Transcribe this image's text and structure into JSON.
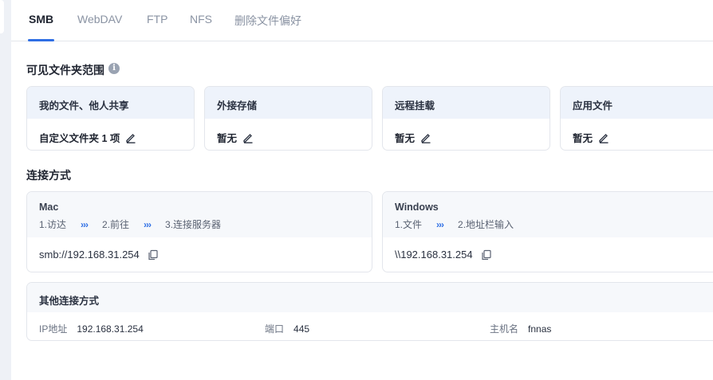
{
  "tabs": [
    "SMB",
    "WebDAV",
    "FTP",
    "NFS",
    "删除文件偏好"
  ],
  "visible_folders": {
    "title": "可见文件夹范围",
    "info_icon": "info-icon",
    "cards": [
      {
        "header": "我的文件、他人共享",
        "value": "自定义文件夹 1 项"
      },
      {
        "header": "外接存储",
        "value": "暂无"
      },
      {
        "header": "远程挂载",
        "value": "暂无"
      },
      {
        "header": "应用文件",
        "value": "暂无"
      }
    ]
  },
  "connection": {
    "title": "连接方式",
    "mac": {
      "label": "Mac",
      "steps": [
        "1.访达",
        "2.前往",
        "3.连接服务器"
      ],
      "address": "smb://192.168.31.254"
    },
    "windows": {
      "label": "Windows",
      "steps": [
        "1.文件",
        "2.地址栏输入"
      ],
      "address": "\\\\192.168.31.254"
    },
    "other": {
      "title": "其他连接方式",
      "ip_label": "IP地址",
      "ip_value": "192.168.31.254",
      "port_label": "端口",
      "port_value": "445",
      "host_label": "主机名",
      "host_value": "fnnas"
    }
  },
  "colors": {
    "accent": "#2f6fe4",
    "card_header": "#eef3fb",
    "border": "#e3e6ec"
  }
}
